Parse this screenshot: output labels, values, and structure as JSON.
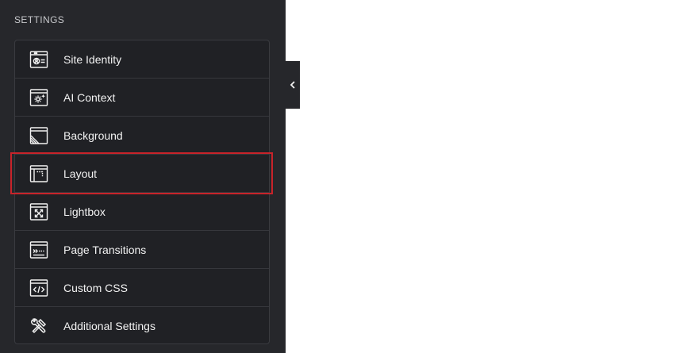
{
  "settings": {
    "section_title": "SETTINGS",
    "items": [
      {
        "label": "Site Identity",
        "icon": "site-identity-icon"
      },
      {
        "label": "AI Context",
        "icon": "ai-context-icon"
      },
      {
        "label": "Background",
        "icon": "background-icon"
      },
      {
        "label": "Layout",
        "icon": "layout-icon"
      },
      {
        "label": "Lightbox",
        "icon": "lightbox-icon"
      },
      {
        "label": "Page Transitions",
        "icon": "page-transitions-icon"
      },
      {
        "label": "Custom CSS",
        "icon": "custom-css-icon"
      },
      {
        "label": "Additional Settings",
        "icon": "additional-settings-icon"
      }
    ],
    "highlighted_item": "Layout"
  },
  "colors": {
    "panel_background": "#26272b",
    "list_background": "#202125",
    "text": "#f2f2f2",
    "highlight_border": "#c8232a",
    "page_background": "#ffffff"
  }
}
